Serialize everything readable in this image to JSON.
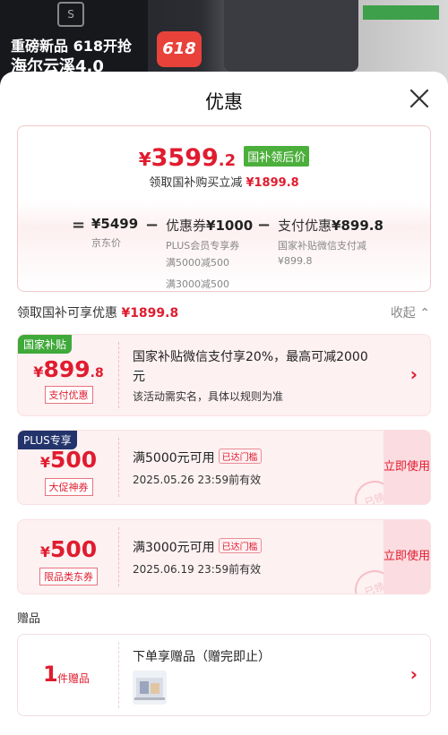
{
  "banner": {
    "logo_text": "S",
    "line1": "重磅新品 618开抢",
    "line2": "海尔云溪4.0",
    "badge": "618"
  },
  "sheet": {
    "title": "优惠"
  },
  "summary": {
    "price_yen": "¥",
    "price_int": "3599",
    "price_dec": ".2",
    "price_tag": "国补领后价",
    "sub_prefix": "领取国补购买立减",
    "sub_amount": "¥1899.8",
    "calc": {
      "eq": "=",
      "minus1": "−",
      "minus2": "−",
      "jd_value": "¥5499",
      "jd_label": "京东价",
      "coupon_label": "优惠券",
      "coupon_value": "¥1000",
      "coupon_sub": "PLUS会员专享券",
      "coupon_sub2": "满5000减500",
      "coupon_sub3": "满3000减500",
      "pay_label": "支付优惠",
      "pay_value": "¥899.8",
      "pay_sub": "国家补贴微信支付减",
      "pay_sub2": "¥899.8"
    }
  },
  "section": {
    "title_prefix": "领取国补可享优惠",
    "title_amount": "¥1899.8",
    "collapse": "收起"
  },
  "coupons": [
    {
      "badge": "国家补贴",
      "yen": "¥",
      "amount": "899",
      "dec": ".8",
      "label": "支付优惠",
      "line1": "国家补贴微信支付享20%，最高可减2000",
      "line1b": "元",
      "line2": "该活动需实名，具体以规则为准"
    },
    {
      "badge": "PLUS专享",
      "yen": "¥",
      "amount": "500",
      "label": "大促神券",
      "line1": "满5000元可用",
      "tag": "已达门槛",
      "line2": "2025.05.26 23:59前有效",
      "button": "立即使用",
      "stamp": "已领"
    },
    {
      "yen": "¥",
      "amount": "500",
      "label": "限品类东券",
      "line1": "满3000元可用",
      "tag": "已达门槛",
      "line2": "2025.06.19 23:59前有效",
      "button": "立即使用",
      "stamp": "已领"
    }
  ],
  "gift": {
    "head": "赠品",
    "count": "1",
    "count_label": "件赠品",
    "title": "下单享赠品（赠完即止）"
  },
  "colors": {
    "accent_red": "#e01c2f",
    "green": "#4caf3c",
    "plus_blue": "#23346c"
  }
}
